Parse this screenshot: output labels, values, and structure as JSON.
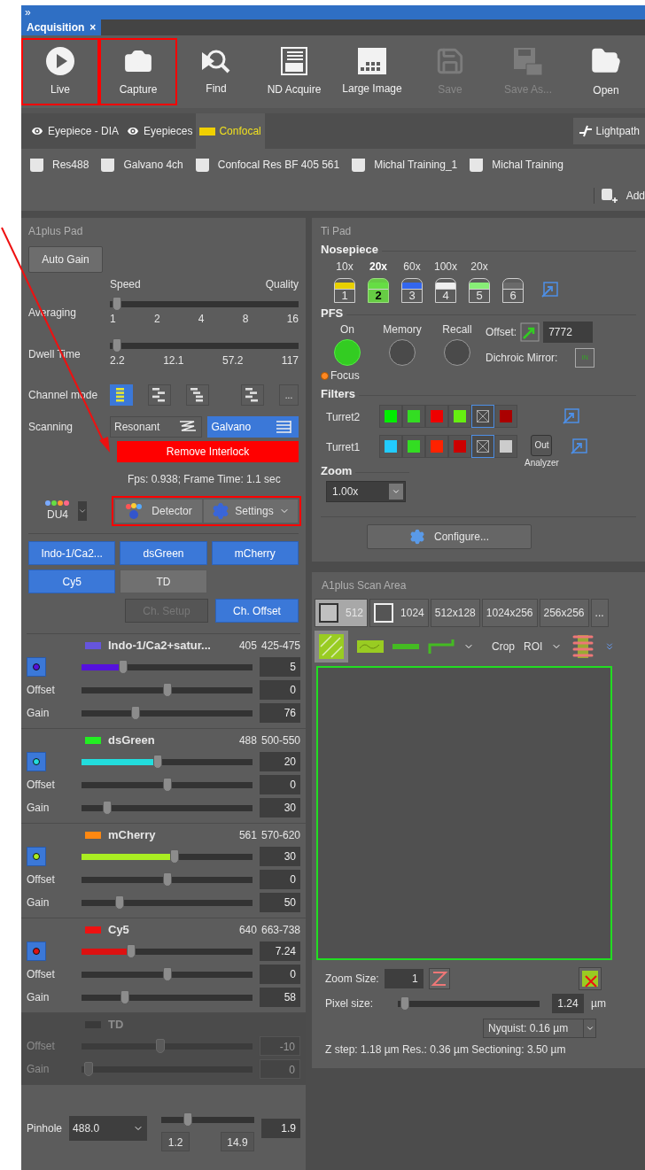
{
  "title_bar": {
    "glyph": "»"
  },
  "tab": {
    "label": "Acquisition",
    "close": "×",
    "selected": true
  },
  "toolbar": [
    {
      "label": "Live",
      "highlighted": true,
      "disabled": false
    },
    {
      "label": "Capture",
      "highlighted": true,
      "disabled": false
    },
    {
      "label": "Find",
      "highlighted": false,
      "disabled": false
    },
    {
      "label": "ND Acquire",
      "highlighted": false,
      "disabled": false
    },
    {
      "label": "Large Image",
      "highlighted": false,
      "disabled": false
    },
    {
      "label": "Save",
      "highlighted": false,
      "disabled": true
    },
    {
      "label": "Save As...",
      "highlighted": false,
      "disabled": true
    },
    {
      "label": "Open",
      "highlighted": false,
      "disabled": false
    }
  ],
  "lightpath_tabs": [
    {
      "label": "Eyepiece - DIA",
      "selected": false
    },
    {
      "label": "Eyepieces",
      "selected": false
    },
    {
      "label": "Confocal",
      "selected": true
    }
  ],
  "lightpath_button": "Lightpath",
  "configurations": [
    "Res488",
    "Galvano 4ch",
    "Confocal Res BF 405 561",
    "Michal Training_1",
    "Michal Training"
  ],
  "add_button": "Add",
  "pointer_arrow": true,
  "a1_pad": {
    "title": "A1plus Pad",
    "auto_gain": "Auto Gain",
    "speed": "Speed",
    "quality": "Quality",
    "averaging": {
      "label": "Averaging",
      "level": 0,
      "ticks": [
        "1",
        "2",
        "4",
        "8",
        "16"
      ]
    },
    "dwell": {
      "label": "Dwell Time",
      "level": 0,
      "ticks": [
        "2.2",
        "12.1",
        "57.2",
        "117"
      ]
    },
    "channel_mode": {
      "label": "Channel mode",
      "modes": [
        {
          "selected": true
        },
        {
          "selected": false
        },
        {
          "selected": false
        },
        {
          "selected": false
        }
      ],
      "more": "..."
    },
    "scanning": {
      "label": "Scanning",
      "options": [
        {
          "label": "Resonant",
          "selected": false
        },
        {
          "label": "Galvano",
          "selected": true
        }
      ]
    },
    "interlock": "Remove Interlock",
    "fps": "Fps: 0.938; Frame Time: 1.1 sec",
    "detector_name": "DU4",
    "detector_group": {
      "highlighted": true,
      "detector": "Detector",
      "settings": "Settings"
    },
    "channel_buttons": [
      {
        "label": "Indo-1/Ca2...",
        "selected": true
      },
      {
        "label": "dsGreen",
        "selected": true
      },
      {
        "label": "mCherry",
        "selected": true
      },
      {
        "label": "Cy5",
        "selected": true
      },
      {
        "label": "TD",
        "selected": false
      }
    ],
    "ch_setup": {
      "label": "Ch. Setup",
      "disabled": true
    },
    "ch_offset": {
      "label": "Ch. Offset",
      "selected": true
    },
    "channels": [
      {
        "name": "Indo-1/Ca2+satur...",
        "color": "#6655dd",
        "laser": "405",
        "emission": "425-475",
        "disabled": false,
        "power": {
          "color": "#5511dd",
          "level": 0.22,
          "value": "5"
        },
        "offset": {
          "label": "Offset",
          "level": 0.5,
          "value": "0"
        },
        "gain": {
          "label": "Gain",
          "level": 0.3,
          "value": "76"
        }
      },
      {
        "name": "dsGreen",
        "color": "#22ee22",
        "laser": "488",
        "emission": "500-550",
        "disabled": false,
        "power": {
          "color": "#22dddd",
          "level": 0.44,
          "value": "20"
        },
        "offset": {
          "label": "Offset",
          "level": 0.5,
          "value": "0"
        },
        "gain": {
          "label": "Gain",
          "level": 0.12,
          "value": "30"
        }
      },
      {
        "name": "mCherry",
        "color": "#ff8811",
        "laser": "561",
        "emission": "570-620",
        "disabled": false,
        "power": {
          "color": "#aaee22",
          "level": 0.55,
          "value": "30"
        },
        "offset": {
          "label": "Offset",
          "level": 0.5,
          "value": "0"
        },
        "gain": {
          "label": "Gain",
          "level": 0.2,
          "value": "50"
        }
      },
      {
        "name": "Cy5",
        "color": "#ee1111",
        "laser": "640",
        "emission": "663-738",
        "disabled": false,
        "power": {
          "color": "#dd1111",
          "level": 0.27,
          "value": "7.24"
        },
        "offset": {
          "label": "Offset",
          "level": 0.5,
          "value": "0"
        },
        "gain": {
          "label": "Gain",
          "level": 0.23,
          "value": "58"
        }
      },
      {
        "name": "TD",
        "color": "#3a3a3a",
        "disabled": true,
        "offset": {
          "label": "Offset",
          "level": 0.46,
          "value": "-10"
        },
        "gain": {
          "label": "Gain",
          "level": 0,
          "value": "0"
        }
      }
    ],
    "pinhole": {
      "label": "Pinhole",
      "value": "488.0",
      "level": 0.25,
      "reading": "1.9",
      "min": "1.2",
      "max": "14.9"
    }
  },
  "ti_pad": {
    "title": "Ti Pad",
    "nosepiece": {
      "title": "Nosepiece",
      "objectives": [
        {
          "label": "10x",
          "number": "1",
          "color": "#e8d000",
          "selected": false
        },
        {
          "label": "20x",
          "number": "2",
          "color": "#66dd44",
          "selected": true
        },
        {
          "label": "60x",
          "number": "3",
          "color": "#3366ee",
          "selected": false
        },
        {
          "label": "100x",
          "number": "4",
          "color": "#eeeeee",
          "selected": false
        },
        {
          "label": "20x",
          "number": "5",
          "color": "#88ee77",
          "selected": false
        },
        {
          "number": "6",
          "color": "#6a6a6a",
          "selected": false
        }
      ]
    },
    "pfs": {
      "title": "PFS",
      "buttons": [
        {
          "label": "On",
          "on": true
        },
        {
          "label": "Memory",
          "on": false
        },
        {
          "label": "Recall",
          "on": false
        }
      ],
      "focus": "Focus",
      "offset_label": "Offset:",
      "offset_value": "7772",
      "dichroic_label": "Dichroic Mirror:",
      "dichroic_value": "IN"
    },
    "filters": {
      "title": "Filters",
      "turrets": [
        {
          "label": "Turret2",
          "slots": [
            {
              "color": "#00ee00",
              "selected": false
            },
            {
              "color": "#33dd22",
              "selected": false
            },
            {
              "color": "#ee0000",
              "selected": false
            },
            {
              "color": "#66ee11",
              "selected": false
            },
            {
              "selected": true
            },
            {
              "color": "#aa0000",
              "selected": false
            }
          ]
        },
        {
          "label": "Turret1",
          "slots": [
            {
              "color": "#22ccff",
              "selected": false
            },
            {
              "color": "#33dd22",
              "selected": false
            },
            {
              "color": "#ff2200",
              "selected": false
            },
            {
              "color": "#cc0000",
              "selected": false
            },
            {
              "selected": true
            },
            {
              "color": "#cccccc",
              "selected": false
            }
          ],
          "out": "Out",
          "analyzer": "Analyzer"
        }
      ]
    },
    "zoom": {
      "title": "Zoom",
      "value": "1.00x"
    },
    "configure": "Configure..."
  },
  "scan_area": {
    "title": "A1plus Scan Area",
    "sizes": [
      {
        "label": "512",
        "selected": true,
        "kind": "square"
      },
      {
        "label": "1024",
        "selected": false,
        "kind": "square"
      },
      {
        "label": "512x128",
        "selected": false,
        "kind": "text"
      },
      {
        "label": "1024x256",
        "selected": false,
        "kind": "text"
      },
      {
        "label": "256x256",
        "selected": false,
        "kind": "text"
      },
      {
        "label": "...",
        "selected": false,
        "kind": "text"
      }
    ],
    "crop": "Crop",
    "roi": "ROI",
    "zoom_size_label": "Zoom Size:",
    "zoom_size": "1",
    "pixel_label": "Pixel size:",
    "pixel_slider": {
      "level": 0
    },
    "pixel_value": "1.24",
    "pixel_unit": "µm",
    "nyquist": "Nyquist: 0.16 µm",
    "z_info": "Z step: 1.18 µm Res.: 0.36 µm Sectioning: 3.50 µm"
  }
}
